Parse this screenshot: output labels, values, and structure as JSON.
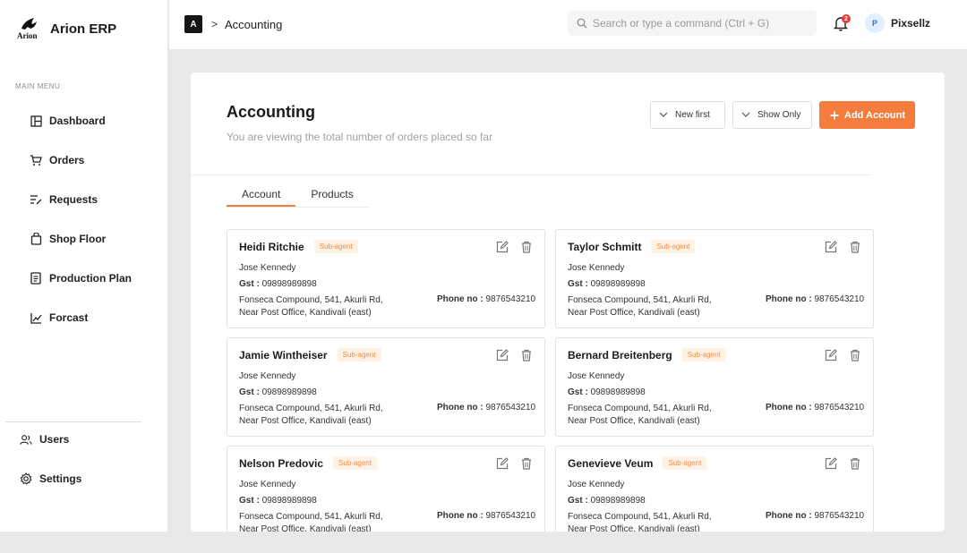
{
  "brand": {
    "logo_text": "Arion",
    "name": "Arion ERP"
  },
  "sidebar": {
    "menu_label": "MAIN MENU",
    "items": [
      {
        "label": "Dashboard",
        "icon": "dashboard-icon"
      },
      {
        "label": "Orders",
        "icon": "cart-icon"
      },
      {
        "label": "Requests",
        "icon": "requests-icon"
      },
      {
        "label": "Shop Floor",
        "icon": "shop-floor-icon"
      },
      {
        "label": "Production Plan",
        "icon": "production-plan-icon"
      },
      {
        "label": "Forcast",
        "icon": "chart-icon"
      }
    ],
    "bottom_items": [
      {
        "label": "Users",
        "icon": "users-icon"
      },
      {
        "label": "Settings",
        "icon": "gear-icon"
      }
    ]
  },
  "topbar": {
    "crumb_badge": "A",
    "crumb_chevron": ">",
    "breadcrumb": "Accounting",
    "search_placeholder": "Search or type a command (Ctrl + G)",
    "notification_count": "2",
    "avatar_initial": "P",
    "user_name": "Pixsellz"
  },
  "main": {
    "title": "Accounting",
    "subtitle": "You are viewing the total number of orders placed so far",
    "sort_label": "New first",
    "filter_label": "Show Only",
    "add_label": "Add Account",
    "tabs": [
      {
        "label": "Account"
      },
      {
        "label": "Products"
      }
    ],
    "cards": [
      {
        "name": "Heidi Ritchie",
        "tag": "Sub-agent",
        "contact": "Jose Kennedy",
        "gst_label": "Gst :",
        "gst": "09898989898",
        "address_1": "Fonseca Compound, 541, Akurli Rd,",
        "address_2": "Near Post Office, Kandivali (east)",
        "phone_label": "Phone no :",
        "phone": "9876543210"
      },
      {
        "name": "Taylor Schmitt",
        "tag": "Sub-agent",
        "contact": "Jose Kennedy",
        "gst_label": "Gst :",
        "gst": "09898989898",
        "address_1": "Fonseca Compound, 541, Akurli Rd,",
        "address_2": "Near Post Office, Kandivali (east)",
        "phone_label": "Phone no :",
        "phone": "9876543210"
      },
      {
        "name": "Jamie Wintheiser",
        "tag": "Sub-agent",
        "contact": "Jose Kennedy",
        "gst_label": "Gst :",
        "gst": "09898989898",
        "address_1": "Fonseca Compound, 541, Akurli Rd,",
        "address_2": "Near Post Office, Kandivali (east)",
        "phone_label": "Phone no :",
        "phone": "9876543210"
      },
      {
        "name": "Bernard Breitenberg",
        "tag": "Sub-agent",
        "contact": "Jose Kennedy",
        "gst_label": "Gst :",
        "gst": "09898989898",
        "address_1": "Fonseca Compound, 541, Akurli Rd,",
        "address_2": "Near Post Office, Kandivali (east)",
        "phone_label": "Phone no :",
        "phone": "9876543210"
      },
      {
        "name": "Nelson Predovic",
        "tag": "Sub-agent",
        "contact": "Jose Kennedy",
        "gst_label": "Gst :",
        "gst": "09898989898",
        "address_1": "Fonseca Compound, 541, Akurli Rd,",
        "address_2": "Near Post Office, Kandivali (east)",
        "phone_label": "Phone no :",
        "phone": "9876543210"
      },
      {
        "name": "Genevieve Veum",
        "tag": "Sub-agent",
        "contact": "Jose Kennedy",
        "gst_label": "Gst :",
        "gst": "09898989898",
        "address_1": "Fonseca Compound, 541, Akurli Rd,",
        "address_2": "Near Post Office, Kandivali (east)",
        "phone_label": "Phone no :",
        "phone": "9876543210"
      }
    ]
  },
  "colors": {
    "accent": "#f47c3c",
    "tag_bg": "#fff1e4",
    "badge": "#e53935"
  }
}
